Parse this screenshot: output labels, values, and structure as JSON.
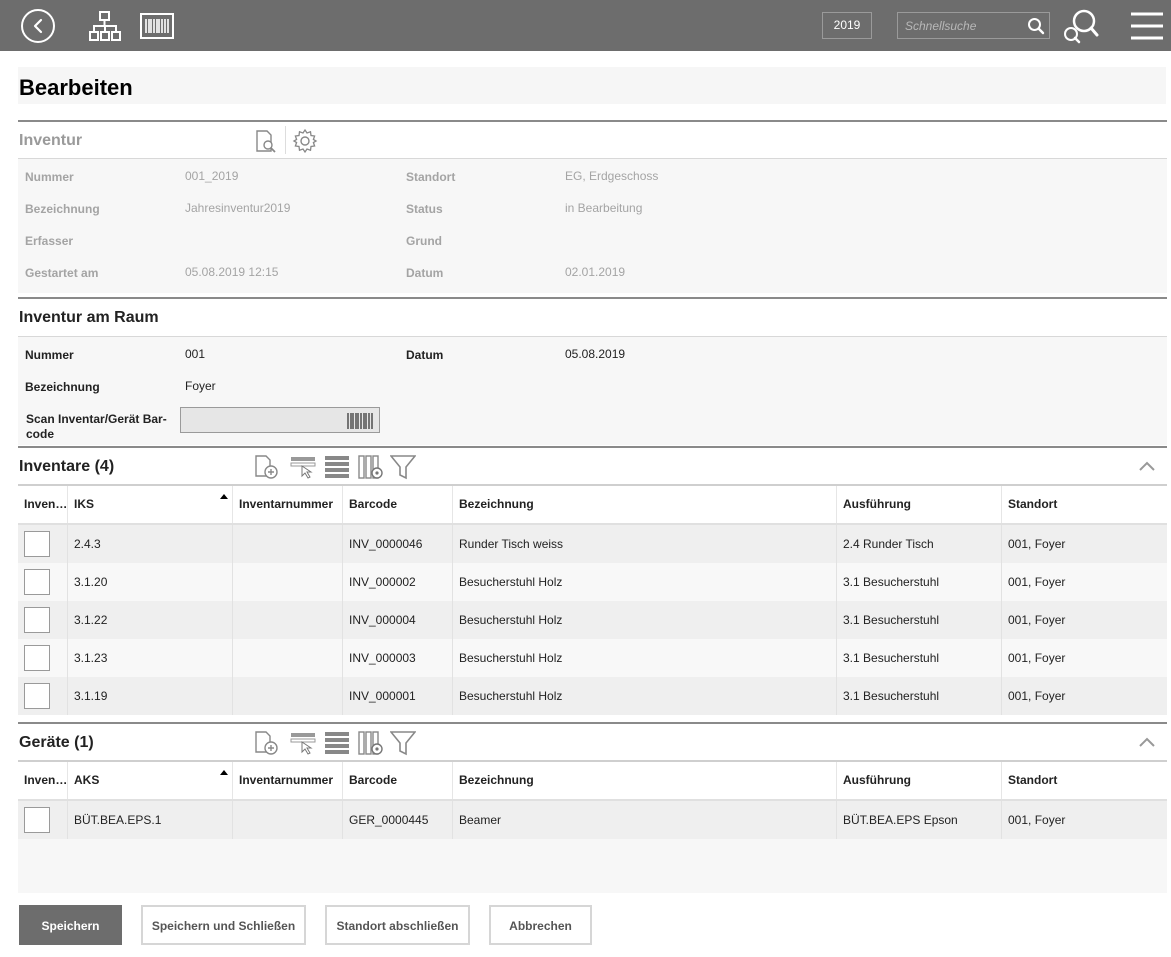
{
  "topbar": {
    "back_icon": "back-circle-icon",
    "tree_icon": "hierarchy-icon",
    "barcode_icon": "barcode-icon",
    "year": "2019",
    "search_placeholder": "Schnellsuche",
    "search_icon": "search-icon",
    "advanced_search_icon": "advanced-search-icon",
    "menu_icon": "hamburger-menu-icon"
  },
  "page": {
    "title": "Bearbeiten"
  },
  "inventur": {
    "heading": "Inventur",
    "fields": {
      "nummer_label": "Nummer",
      "nummer_value": "001_2019",
      "bezeichnung_label": "Bezeichnung",
      "bezeichnung_value": "Jahresinventur2019",
      "erfasser_label": "Erfasser",
      "erfasser_value": "",
      "gestartet_label": "Gestartet am",
      "gestartet_value": "05.08.2019 12:15",
      "standort_label": "Standort",
      "standort_value": "EG, Erdgeschoss",
      "status_label": "Status",
      "status_value": "in Bearbeitung",
      "grund_label": "Grund",
      "grund_value": "",
      "datum_label": "Datum",
      "datum_value": "02.01.2019"
    }
  },
  "raum": {
    "heading": "Inventur am Raum",
    "nummer_label": "Nummer",
    "nummer_value": "001",
    "datum_label": "Datum",
    "datum_value": "05.08.2019",
    "bezeichnung_label": "Bezeichnung",
    "bezeichnung_value": "Foyer",
    "scan_label_1": "Scan Inventar/Gerät Bar-",
    "scan_label_2": "code",
    "scan_value": ""
  },
  "inventare": {
    "heading": "Inventare (4)",
    "columns": [
      "Inven…",
      "IKS",
      "Inventarnummer",
      "Barcode",
      "Bezeichnung",
      "Ausführung",
      "Standort"
    ],
    "rows": [
      {
        "iks": "2.4.3",
        "invnr": "",
        "barcode": "INV_0000046",
        "bez": "Runder Tisch weiss",
        "ausf": "2.4 Runder Tisch",
        "standort": "001, Foyer"
      },
      {
        "iks": "3.1.20",
        "invnr": "",
        "barcode": "INV_000002",
        "bez": "Besucherstuhl Holz",
        "ausf": "3.1 Besucherstuhl",
        "standort": "001, Foyer"
      },
      {
        "iks": "3.1.22",
        "invnr": "",
        "barcode": "INV_000004",
        "bez": "Besucherstuhl Holz",
        "ausf": "3.1 Besucherstuhl",
        "standort": "001, Foyer"
      },
      {
        "iks": "3.1.23",
        "invnr": "",
        "barcode": "INV_000003",
        "bez": "Besucherstuhl Holz",
        "ausf": "3.1 Besucherstuhl",
        "standort": "001, Foyer"
      },
      {
        "iks": "3.1.19",
        "invnr": "",
        "barcode": "INV_000001",
        "bez": "Besucherstuhl Holz",
        "ausf": "3.1 Besucherstuhl",
        "standort": "001, Foyer"
      }
    ]
  },
  "geraete": {
    "heading": "Geräte (1)",
    "columns": [
      "Inven…",
      "AKS",
      "Inventarnummer",
      "Barcode",
      "Bezeichnung",
      "Ausführung",
      "Standort"
    ],
    "rows": [
      {
        "aks": "BÜT.BEA.EPS.1",
        "invnr": "",
        "barcode": "GER_0000445",
        "bez": "Beamer",
        "ausf": "BÜT.BEA.EPS Epson",
        "standort": "001, Foyer"
      }
    ]
  },
  "buttons": {
    "save": "Speichern",
    "save_close": "Speichern und Schließen",
    "close_location": "Standort abschließen",
    "cancel": "Abbrechen"
  }
}
